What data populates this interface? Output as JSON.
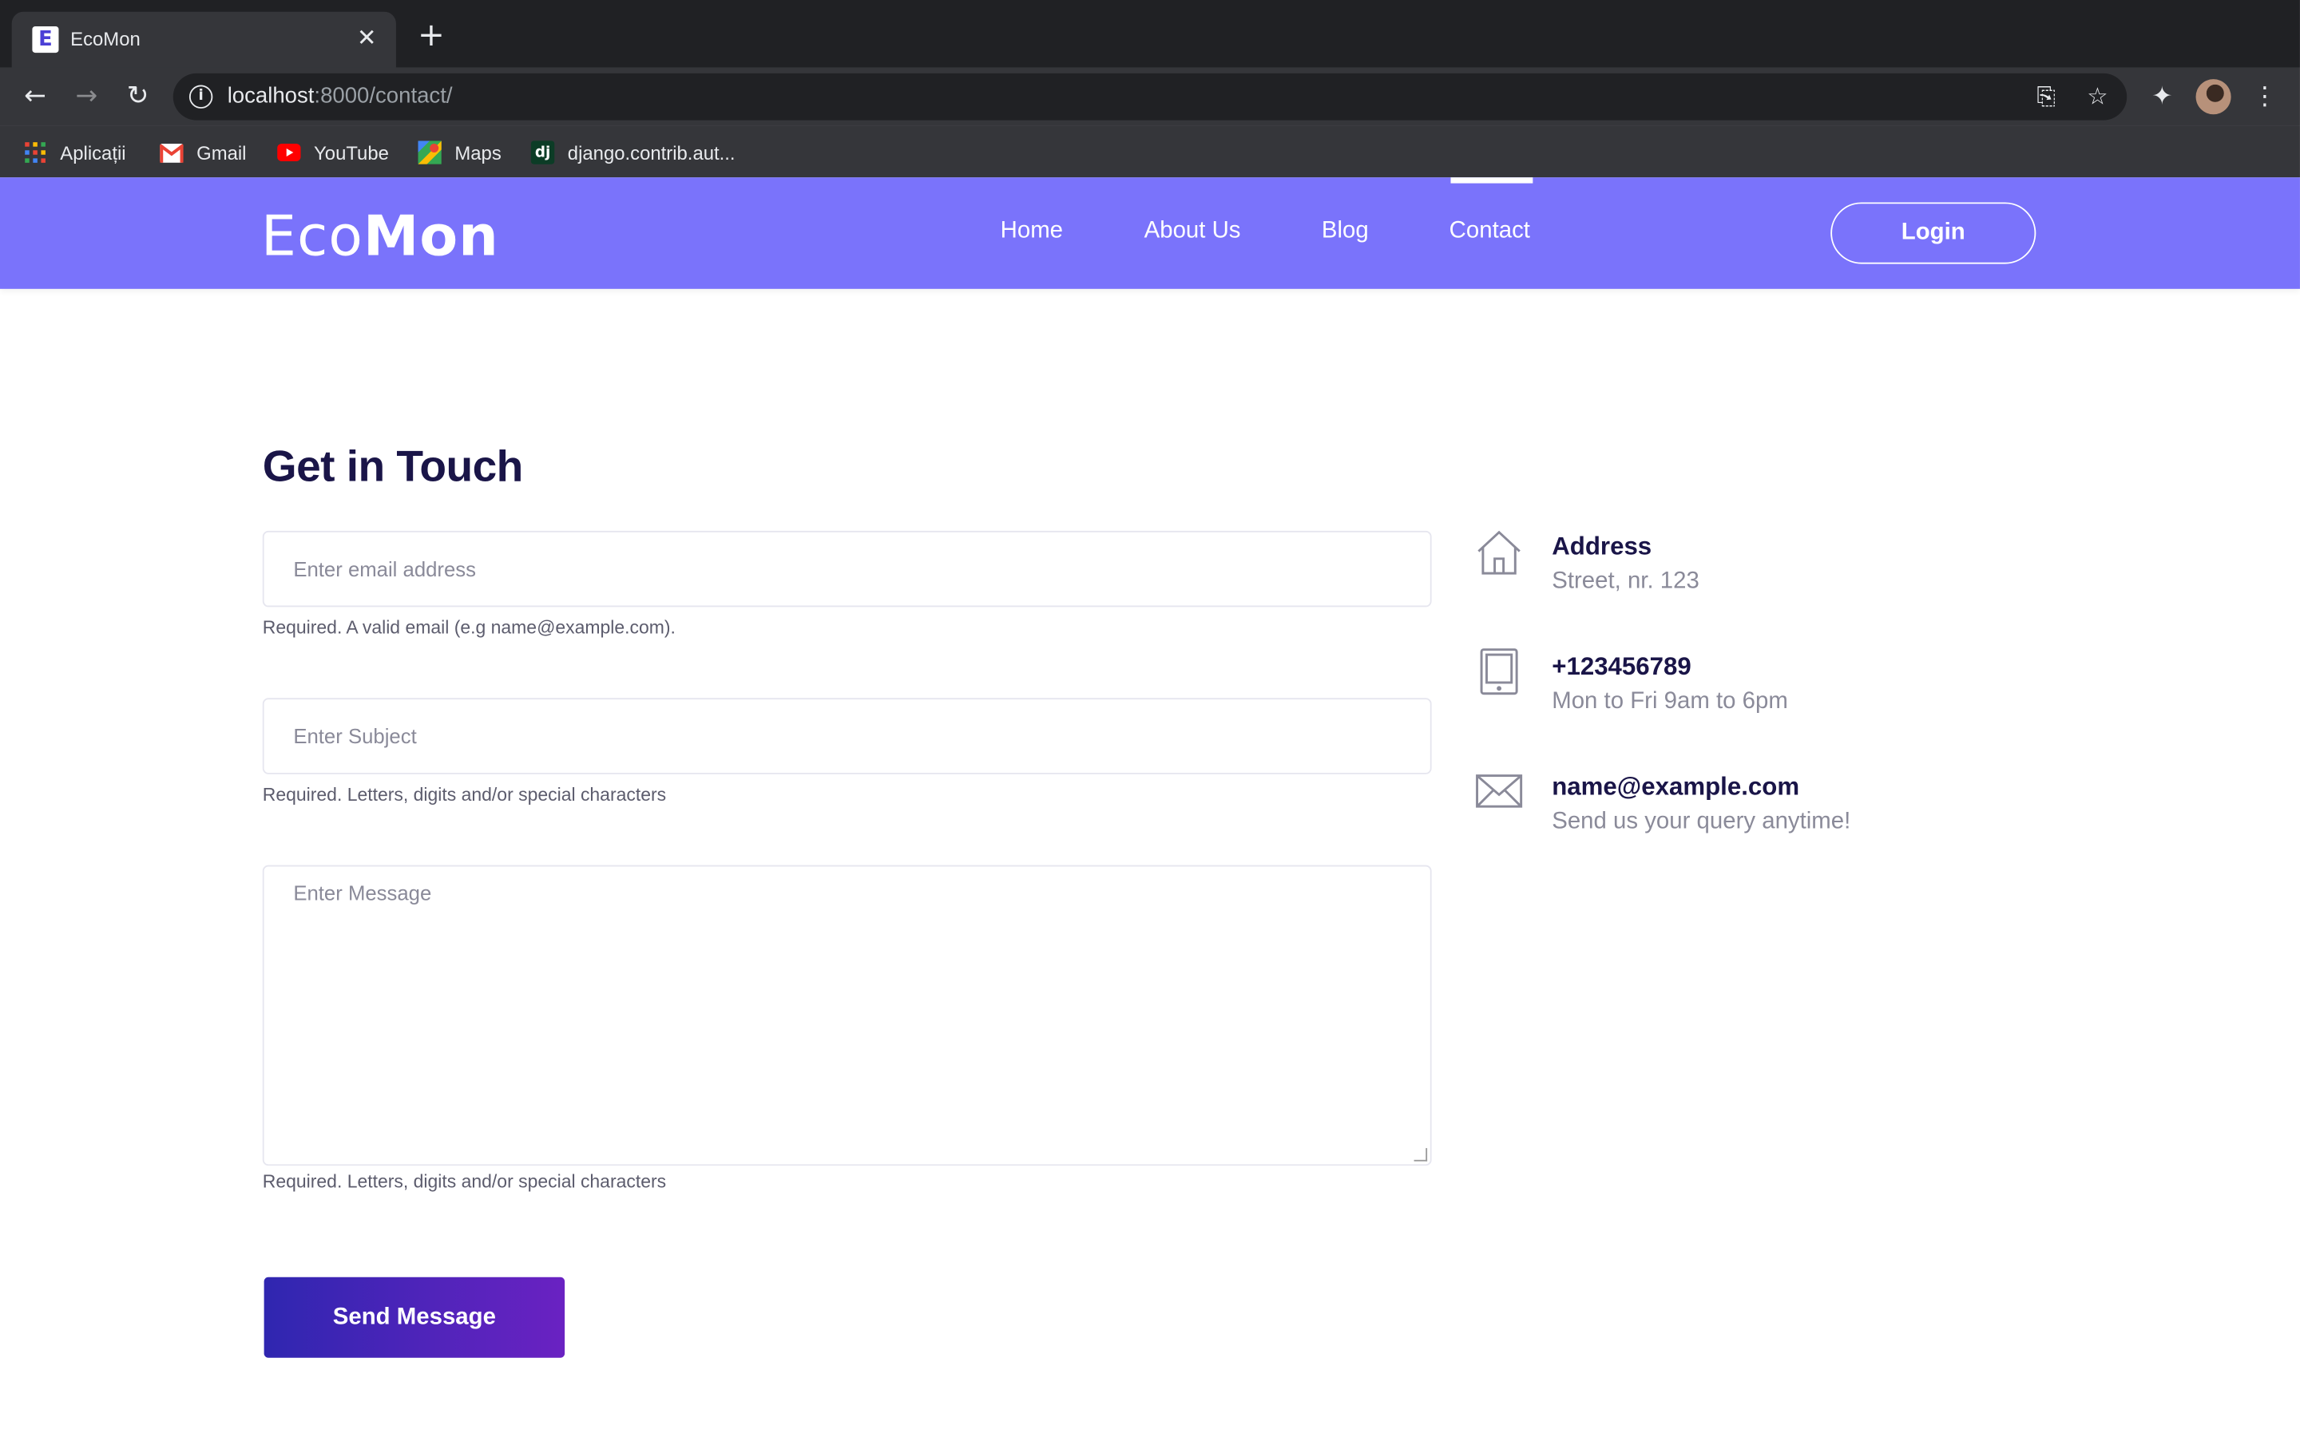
{
  "browser": {
    "tab_title": "EcoMon",
    "tab_favicon_letter": "E",
    "url_host": "localhost",
    "url_path": ":8000/contact/",
    "bookmarks": [
      {
        "label": "Aplicații",
        "icon": "apps-grid-icon"
      },
      {
        "label": "Gmail",
        "icon": "gmail-icon"
      },
      {
        "label": "YouTube",
        "icon": "youtube-icon"
      },
      {
        "label": "Maps",
        "icon": "maps-icon"
      },
      {
        "label": "django.contrib.aut...",
        "icon": "django-icon",
        "icon_text": "dj"
      }
    ]
  },
  "header": {
    "logo_light": "Eco",
    "logo_bold": "Mon",
    "nav": [
      {
        "label": "Home"
      },
      {
        "label": "About Us"
      },
      {
        "label": "Blog"
      },
      {
        "label": "Contact",
        "active": true
      }
    ],
    "login_label": "Login",
    "background_color": "#7a73fb"
  },
  "contact": {
    "title": "Get in Touch",
    "email_placeholder": "Enter email address",
    "email_help": "Required. A valid email (e.g name@example.com).",
    "subject_placeholder": "Enter Subject",
    "subject_help": "Required. Letters, digits and/or special characters",
    "message_placeholder": "Enter Message",
    "message_help": "Required. Letters, digits and/or special characters",
    "send_label": "Send Message"
  },
  "info": {
    "address_title": "Address",
    "address_sub": "Street, nr. 123",
    "phone_title": "+123456789",
    "phone_sub": "Mon to Fri 9am to 6pm",
    "email_title": "name@example.com",
    "email_sub": "Send us your query anytime!"
  }
}
